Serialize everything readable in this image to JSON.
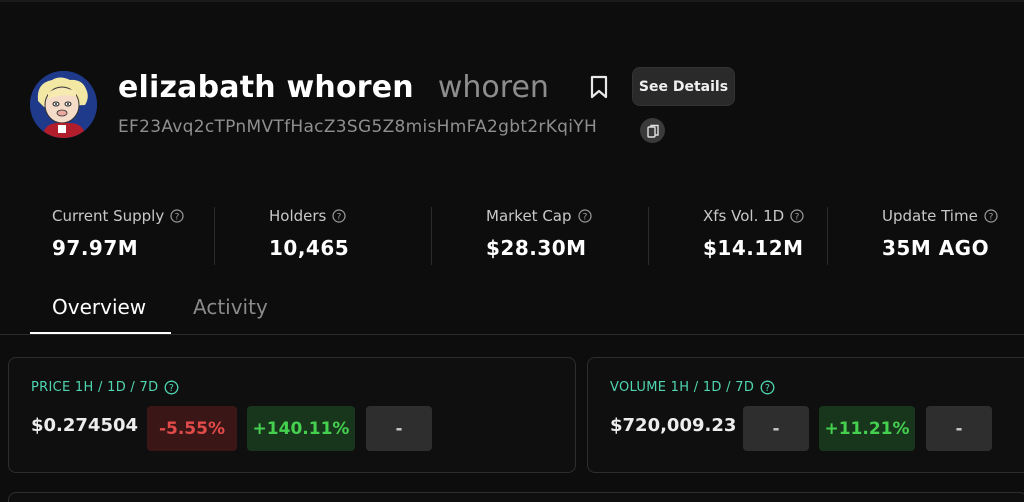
{
  "token": {
    "name": "elizabath whoren",
    "symbol": "whoren",
    "address": "EF23Avq2cTPnMVTfHacZ3SG5Z8misHmFA2gbt2rKqiYH",
    "details_label": "See Details"
  },
  "stats": [
    {
      "label": "Current Supply",
      "value": "97.97M"
    },
    {
      "label": "Holders",
      "value": "10,465"
    },
    {
      "label": "Market Cap",
      "value": "$28.30M"
    },
    {
      "label": "Xfs Vol. 1D",
      "value": "$14.12M"
    },
    {
      "label": "Update Time",
      "value": "35M AGO"
    }
  ],
  "tabs": [
    {
      "label": "Overview",
      "active": true
    },
    {
      "label": "Activity",
      "active": false
    }
  ],
  "price_card": {
    "title": "PRICE 1H / 1D / 7D",
    "value": "$0.274504",
    "changes": [
      "-5.55%",
      "+140.11%",
      "-"
    ]
  },
  "volume_card": {
    "title": "VOLUME 1H / 1D / 7D",
    "value": "$720,009.23",
    "changes": [
      "-",
      "+11.21%",
      "-"
    ]
  },
  "colors": {
    "accent": "#4fd6b0",
    "negative": "#e34a4a",
    "positive": "#45d04f",
    "background": "#0e0d0d"
  },
  "icons": {
    "bookmark": "bookmark-icon",
    "copy": "copy-icon",
    "help": "question-circle-icon"
  }
}
